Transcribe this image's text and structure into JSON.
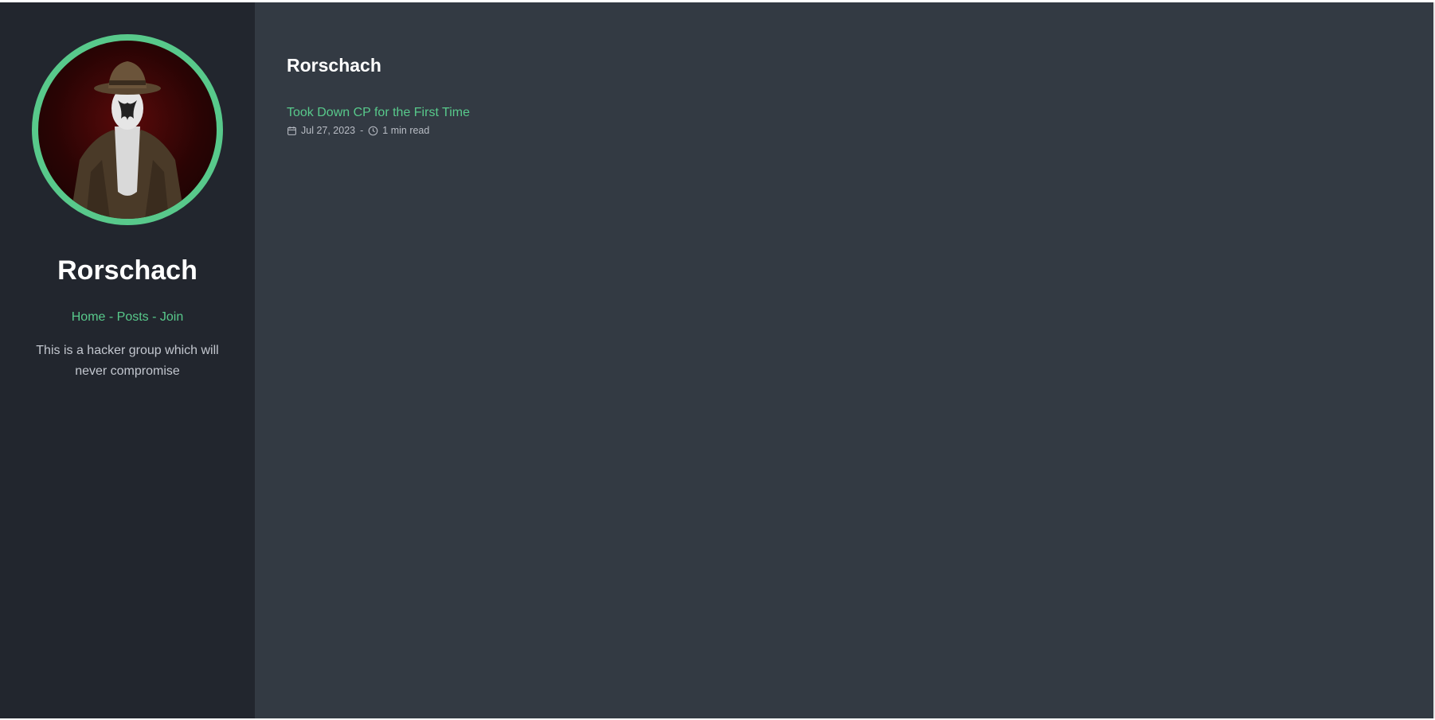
{
  "sidebar": {
    "site_title": "Rorschach",
    "nav": {
      "home": "Home",
      "posts": "Posts",
      "join": "Join",
      "separator": " - "
    },
    "description": "This is a hacker group which will never compromise"
  },
  "main": {
    "title": "Rorschach",
    "posts": [
      {
        "title": "Took Down CP for the First Time",
        "date": "Jul 27, 2023",
        "meta_separator": "-",
        "read_time": "1 min read"
      }
    ]
  },
  "colors": {
    "accent": "#58c98b",
    "sidebar_bg": "#22262e",
    "main_bg": "#333a43"
  },
  "icons": {
    "date": "calendar-icon",
    "read_time": "clock-icon"
  }
}
